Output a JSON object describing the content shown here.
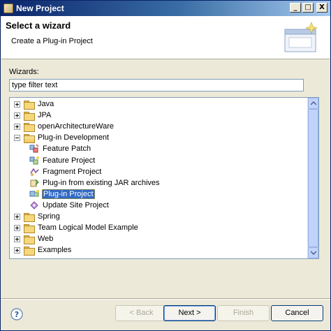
{
  "window": {
    "title": "New Project"
  },
  "title_controls": {
    "minimize": "_",
    "maximize": "□",
    "close": "X"
  },
  "header": {
    "title": "Select a wizard",
    "description": "Create a Plug-in Project",
    "icon": "wizard-banner-icon"
  },
  "wizards": {
    "label": "Wizards:",
    "filter_value": "type filter text",
    "tree": [
      {
        "label": "Java",
        "type": "folder",
        "expanded": false,
        "depth": 0
      },
      {
        "label": "JPA",
        "type": "folder",
        "expanded": false,
        "depth": 0
      },
      {
        "label": "openArchitectureWare",
        "type": "folder",
        "expanded": false,
        "depth": 0
      },
      {
        "label": "Plug-in Development",
        "type": "folder",
        "expanded": true,
        "depth": 0
      },
      {
        "label": "Feature Patch",
        "type": "wizard",
        "icon": "feature-patch-icon",
        "depth": 1
      },
      {
        "label": "Feature Project",
        "type": "wizard",
        "icon": "feature-project-icon",
        "depth": 1
      },
      {
        "label": "Fragment Project",
        "type": "wizard",
        "icon": "fragment-project-icon",
        "depth": 1
      },
      {
        "label": "Plug-in from existing JAR archives",
        "type": "wizard",
        "icon": "plugin-jar-icon",
        "depth": 1
      },
      {
        "label": "Plug-in Project",
        "type": "wizard",
        "icon": "plugin-project-icon",
        "depth": 1,
        "selected": true
      },
      {
        "label": "Update Site Project",
        "type": "wizard",
        "icon": "update-site-icon",
        "depth": 1
      },
      {
        "label": "Spring",
        "type": "folder",
        "expanded": false,
        "depth": 0
      },
      {
        "label": "Team Logical Model Example",
        "type": "folder",
        "expanded": false,
        "depth": 0
      },
      {
        "label": "Web",
        "type": "folder",
        "expanded": false,
        "depth": 0
      },
      {
        "label": "Examples",
        "type": "folder",
        "expanded": false,
        "depth": 0
      }
    ]
  },
  "buttons": {
    "help_icon": "help-icon",
    "back": "< Back",
    "next": "Next >",
    "finish": "Finish",
    "cancel": "Cancel"
  },
  "colors": {
    "selection": "#316ac5",
    "titlebar": "#0a246a",
    "dialog_bg": "#ece9d8"
  }
}
